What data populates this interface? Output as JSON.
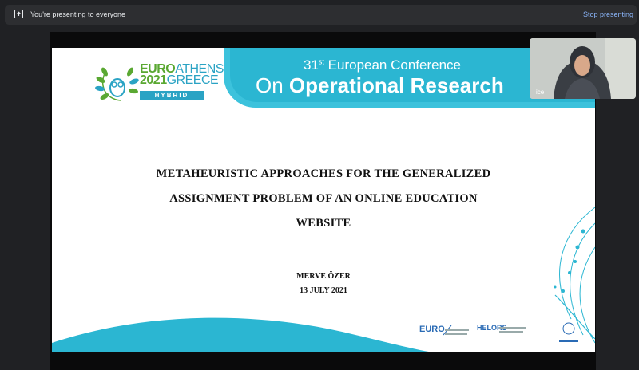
{
  "top_bar": {
    "presenting_text": "You're presenting to everyone",
    "stop_label": "Stop presenting"
  },
  "slide": {
    "logo": {
      "brand_line1a": "EURO",
      "brand_line1b": "ATHENS",
      "brand_line2a": "2021",
      "brand_line2b": "GREECE",
      "tag": "HYBRID"
    },
    "banner": {
      "edition": "31",
      "edition_suffix": "st",
      "line1_rest": " European Conference",
      "line2_a": "On ",
      "line2_b": "Operational Research"
    },
    "title_lines": [
      "METAHEURISTIC APPROACHES FOR THE GENERALIZED",
      "ASSIGNMENT PROBLEM OF AN ONLINE EDUCATION",
      "WEBSITE"
    ],
    "author": "MERVE ÖZER",
    "date": "13 JULY 2021",
    "footer": {
      "euro": "EURO",
      "helors": "HELORS"
    }
  },
  "video": {
    "name_label": "ice"
  },
  "colors": {
    "accent_blue": "#8ab4f8",
    "banner_cyan": "#2bb6d2",
    "logo_green": "#5aa832"
  }
}
